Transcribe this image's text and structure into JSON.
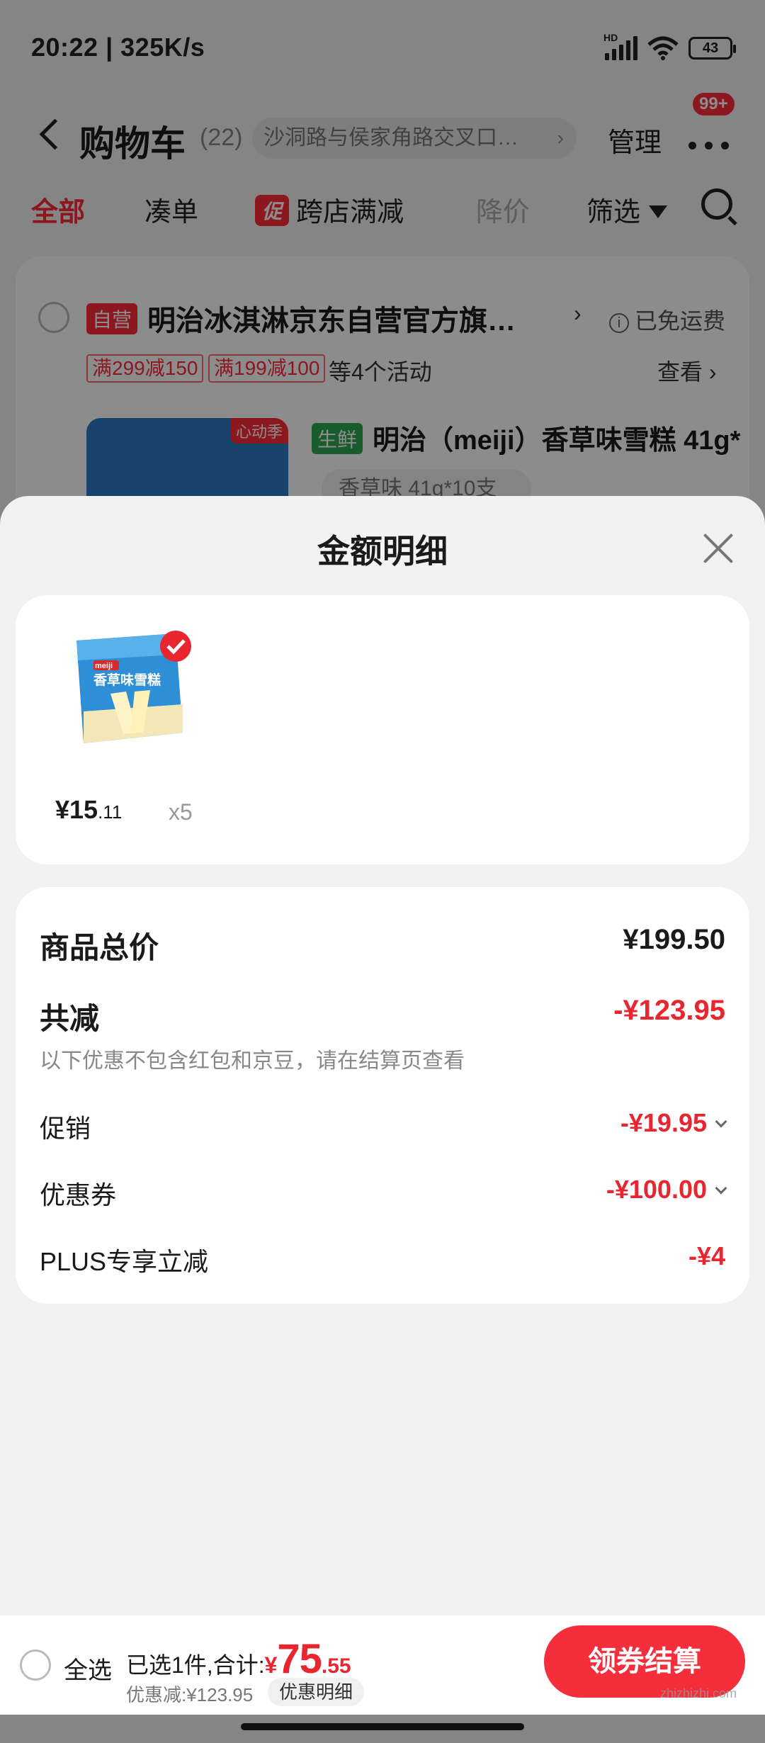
{
  "status_bar": {
    "time": "20:22 | 325K/s",
    "network_type": "HD",
    "battery": "43"
  },
  "nav": {
    "title": "购物车",
    "count": "(22)",
    "address": "沙洞路与侯家角路交叉口…",
    "manage": "管理",
    "badge": "99+"
  },
  "filters": {
    "all": "全部",
    "combine": "凑单",
    "promo_tag": "促",
    "cross_store": "跨店满减",
    "price_drop": "降价",
    "filter": "筛选"
  },
  "store": {
    "self_badge": "自营",
    "name": "明治冰淇淋京东自营官方旗…",
    "shipping": "已免运费",
    "promos": [
      "满299减150",
      "满199减100"
    ],
    "more_activities": "等4个活动",
    "view": "查看 ›",
    "product_tag": "心动季",
    "fresh_badge": "生鲜",
    "product_name": "明治（meiji）香草味雪糕 41g*",
    "spec": "香草味 41g*10支"
  },
  "sheet": {
    "title": "金额明细",
    "item": {
      "brand": "meiji",
      "name_on_box": "香草味雪糕",
      "price_int": "¥15",
      "price_dec": ".11",
      "qty": "x5"
    },
    "rows": {
      "total_label": "商品总价",
      "total_value": "¥199.50",
      "reduce_label": "共减",
      "reduce_value": "-¥123.95",
      "note": "以下优惠不包含红包和京豆，请在结算页查看",
      "promo_label": "促销",
      "promo_value": "-¥19.95",
      "coupon_label": "优惠券",
      "coupon_value": "-¥100.00",
      "plus_label": "PLUS专享立减",
      "plus_value": "-¥4"
    }
  },
  "bottom": {
    "select_all": "全选",
    "summary_prefix": "已选1件,合计:",
    "yen": "¥",
    "total_int": "75",
    "total_dec": ".55",
    "discount": "优惠减:¥123.95",
    "detail_btn": "优惠明细",
    "checkout": "领券结算"
  },
  "watermark": "zhizhizhi.com",
  "colors": {
    "accent_red": "#e8262f",
    "button_red": "#f52e3c",
    "fresh_green": "#2fa84f"
  }
}
